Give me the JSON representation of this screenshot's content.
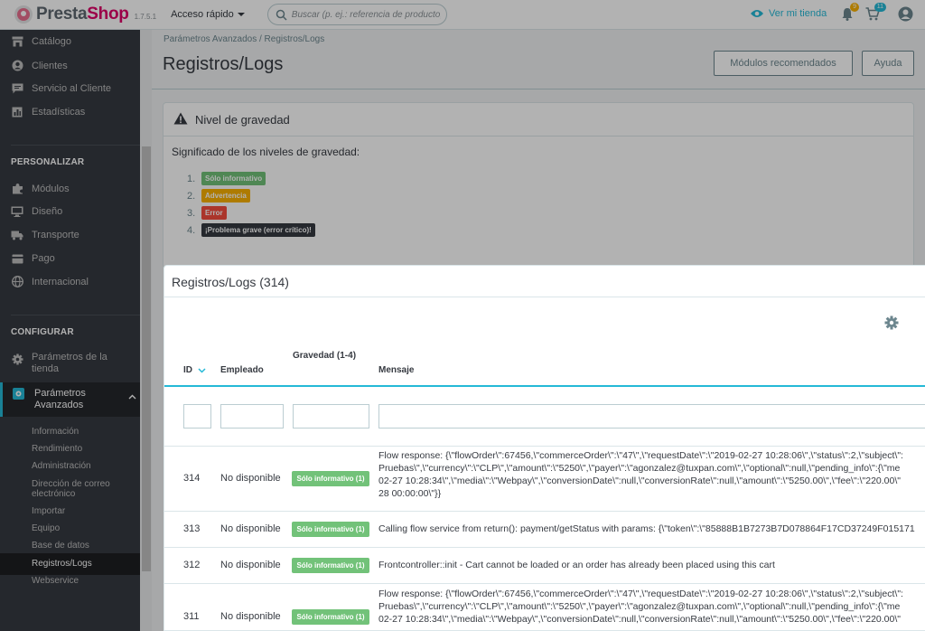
{
  "header": {
    "logo_part1": "Presta",
    "logo_part2": "Shop",
    "version": "1.7.5.1",
    "quick_access": "Acceso rápido",
    "search_placeholder": "Buscar (p. ej.: referencia de producto, n",
    "view_store": "Ver mi tienda",
    "notif_orders": "9",
    "notif_customers": "11"
  },
  "sidebar": {
    "items_top": [
      {
        "label": "Catálogo",
        "icon": "store-icon"
      },
      {
        "label": "Clientes",
        "icon": "user-icon"
      },
      {
        "label": "Servicio al Cliente",
        "icon": "chat-icon"
      },
      {
        "label": "Estadísticas",
        "icon": "chart-icon"
      }
    ],
    "section_personalize": "PERSONALIZAR",
    "items_personalize": [
      {
        "label": "Módulos",
        "icon": "puzzle-icon"
      },
      {
        "label": "Diseño",
        "icon": "monitor-icon"
      },
      {
        "label": "Transporte",
        "icon": "truck-icon"
      },
      {
        "label": "Pago",
        "icon": "card-icon"
      },
      {
        "label": "Internacional",
        "icon": "globe-icon"
      }
    ],
    "section_configure": "CONFIGURAR",
    "store_params": "Parámetros de la tienda",
    "advanced_params": "Parámetros Avanzados",
    "sub_items": [
      "Información",
      "Rendimiento",
      "Administración",
      "Dirección de correo electrónico",
      "Importar",
      "Equipo",
      "Base de datos",
      "Registros/Logs",
      "Webservice"
    ]
  },
  "page": {
    "breadcrumb": "Parámetros Avanzados  /  Registros/Logs",
    "title": "Registros/Logs",
    "btn_modules": "Módulos recomendados",
    "btn_help": "Ayuda"
  },
  "severity_panel": {
    "title": "Nivel de gravedad",
    "description": "Significado de los niveles de gravedad:",
    "levels": [
      {
        "n": "1.",
        "label": "Sólo informativo",
        "color": "#72c279"
      },
      {
        "n": "2.",
        "label": "Advertencia",
        "color": "#fab000"
      },
      {
        "n": "3.",
        "label": "Error",
        "color": "#f54c3e"
      },
      {
        "n": "4.",
        "label": "¡Problema grave (error crítico)!",
        "color": "#363a41"
      }
    ]
  },
  "logs_panel": {
    "title": "Registros/Logs (314)",
    "columns": {
      "id": "ID",
      "employee": "Empleado",
      "severity": "Gravedad (1-4)",
      "message": "Mensaje"
    },
    "rows": [
      {
        "id": "314",
        "employee": "No disponible",
        "severity": "Sólo informativo (1)",
        "message": [
          "Flow response: {\\\"flowOrder\\\":67456,\\\"commerceOrder\\\":\\\"47\\\",\\\"requestDate\\\":\\\"2019-02-27 10:28:06\\\",\\\"status\\\":2,\\\"subject\\\":",
          "Pruebas\\\",\\\"currency\\\":\\\"CLP\\\",\\\"amount\\\":\\\"5250\\\",\\\"payer\\\":\\\"agonzalez@tuxpan.com\\\",\\\"optional\\\":null,\\\"pending_info\\\":{\\\"me",
          "02-27 10:28:34\\\",\\\"media\\\":\\\"Webpay\\\",\\\"conversionDate\\\":null,\\\"conversionRate\\\":null,\\\"amount\\\":\\\"5250.00\\\",\\\"fee\\\":\\\"220.00\\\"",
          "28 00:00:00\\\"}}"
        ]
      },
      {
        "id": "313",
        "employee": "No disponible",
        "severity": "Sólo informativo (1)",
        "message": [
          "Calling flow service from return(): payment/getStatus with params: {\\\"token\\\":\\\"85888B1B7273B7D078864F17CD37249F015171"
        ]
      },
      {
        "id": "312",
        "employee": "No disponible",
        "severity": "Sólo informativo (1)",
        "message": [
          "Frontcontroller::init - Cart cannot be loaded or an order has already been placed using this cart"
        ]
      },
      {
        "id": "311",
        "employee": "No disponible",
        "severity": "Sólo informativo (1)",
        "message": [
          "Flow response: {\\\"flowOrder\\\":67456,\\\"commerceOrder\\\":\\\"47\\\",\\\"requestDate\\\":\\\"2019-02-27 10:28:06\\\",\\\"status\\\":2,\\\"subject\\\":",
          "Pruebas\\\",\\\"currency\\\":\\\"CLP\\\",\\\"amount\\\":\\\"5250\\\",\\\"payer\\\":\\\"agonzalez@tuxpan.com\\\",\\\"optional\\\":null,\\\"pending_info\\\":{\\\"me",
          "02-27 10:28:34\\\",\\\"media\\\":\\\"Webpay\\\",\\\"conversionDate\\\":null,\\\"conversionRate\\\":null,\\\"amount\\\":\\\"5250.00\\\",\\\"fee\\\":\\\"220.00\\\""
        ]
      }
    ]
  },
  "colors": {
    "accent": "#25b9d7",
    "brand": "#df0067",
    "sidebar": "#363a41",
    "success": "#72c279"
  }
}
